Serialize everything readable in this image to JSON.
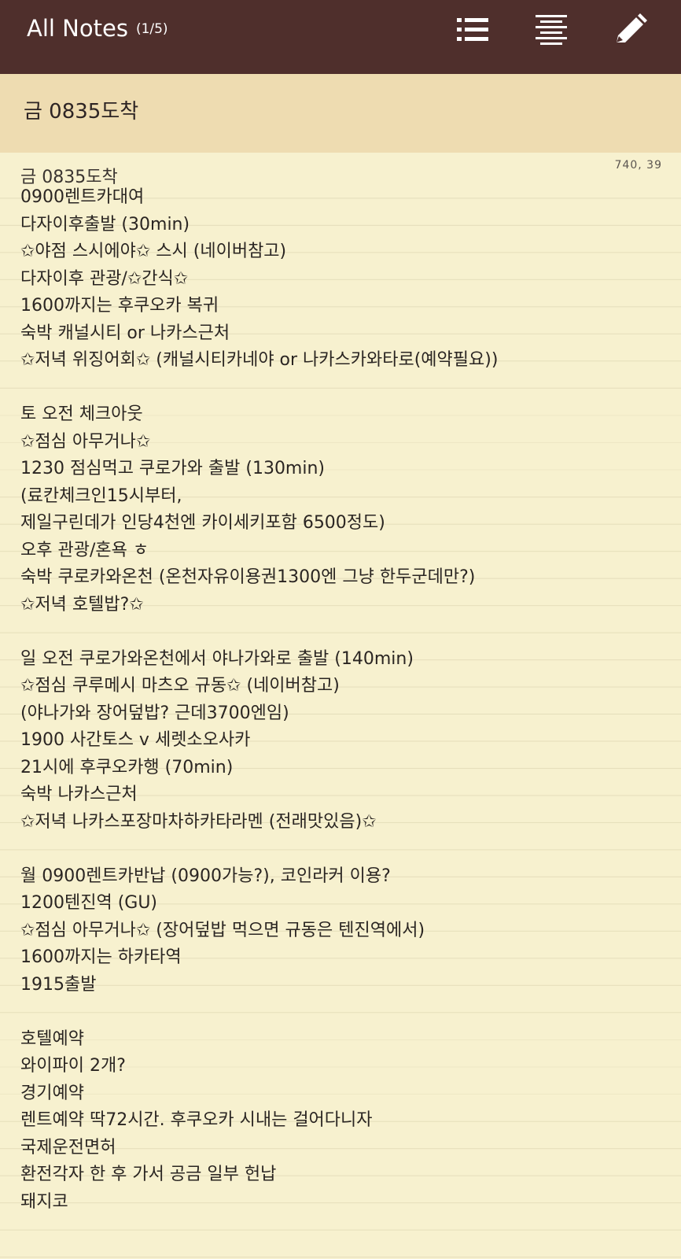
{
  "header": {
    "title": "All Notes",
    "count": "(1/5)",
    "icons": [
      "list-view-icon",
      "text-align-icon",
      "pencil-icon"
    ]
  },
  "note": {
    "title": "금 0835도착",
    "meta": "740, 39",
    "lines": [
      "금 0835도착",
      "0900렌트카대여",
      "다자이후출발 (30min)",
      "✩야점 스시에야✩ 스시 (네이버참고)",
      "다자이후 관광/✩간식✩",
      "1600까지는 후쿠오카 복귀",
      "숙박 캐널시티 or 나카스근처",
      "✩저녁 위징어회✩ (캐널시티카네야 or 나카스카와타로(예약필요))",
      "",
      "토 오전 체크아웃",
      "✩점심 아무거나✩",
      "1230 점심먹고 쿠로가와 출발 (130min)",
      "(료칸체크인15시부터,",
      "제일구린데가 인당4천엔 카이세키포함 6500정도)",
      "오후 관광/혼욕 ㅎ",
      "숙박 쿠로카와온천 (온천자유이용권1300엔 그냥 한두군데만?)",
      "✩저녁 호텔밥?✩",
      "",
      "일 오전 쿠로가와온천에서 야나가와로 출발 (140min)",
      "✩점심 쿠루메시 마츠오 규동✩ (네이버참고)",
      "(야나가와 장어덮밥? 근데3700엔임)",
      "1900 사간토스 v 세렛소오사카",
      "21시에 후쿠오카행 (70min)",
      "숙박 나카스근처",
      "✩저녁 나카스포장마차하카타라멘 (전래맛있음)✩",
      "",
      "월 0900렌트카반납 (0900가능?), 코인라커 이용?",
      "1200텐진역 (GU)",
      "✩점심 아무거나✩ (장어덮밥 먹으면 규동은 텐진역에서)",
      "1600까지는 하카타역",
      "1915출발",
      "",
      "호텔예약",
      "와이파이 2개?",
      "경기예약",
      "렌트예약 딱72시간. 후쿠오카 시내는 걸어다니자",
      "국제운전면허",
      "환전각자 한 후 가서 공금 일부 헌납",
      "돼지코"
    ]
  },
  "colors": {
    "app_bar": "#4f2f2c",
    "title_band": "#eedcb1",
    "paper": "#f7f1cf",
    "rule_line": "#e6dfbc"
  }
}
